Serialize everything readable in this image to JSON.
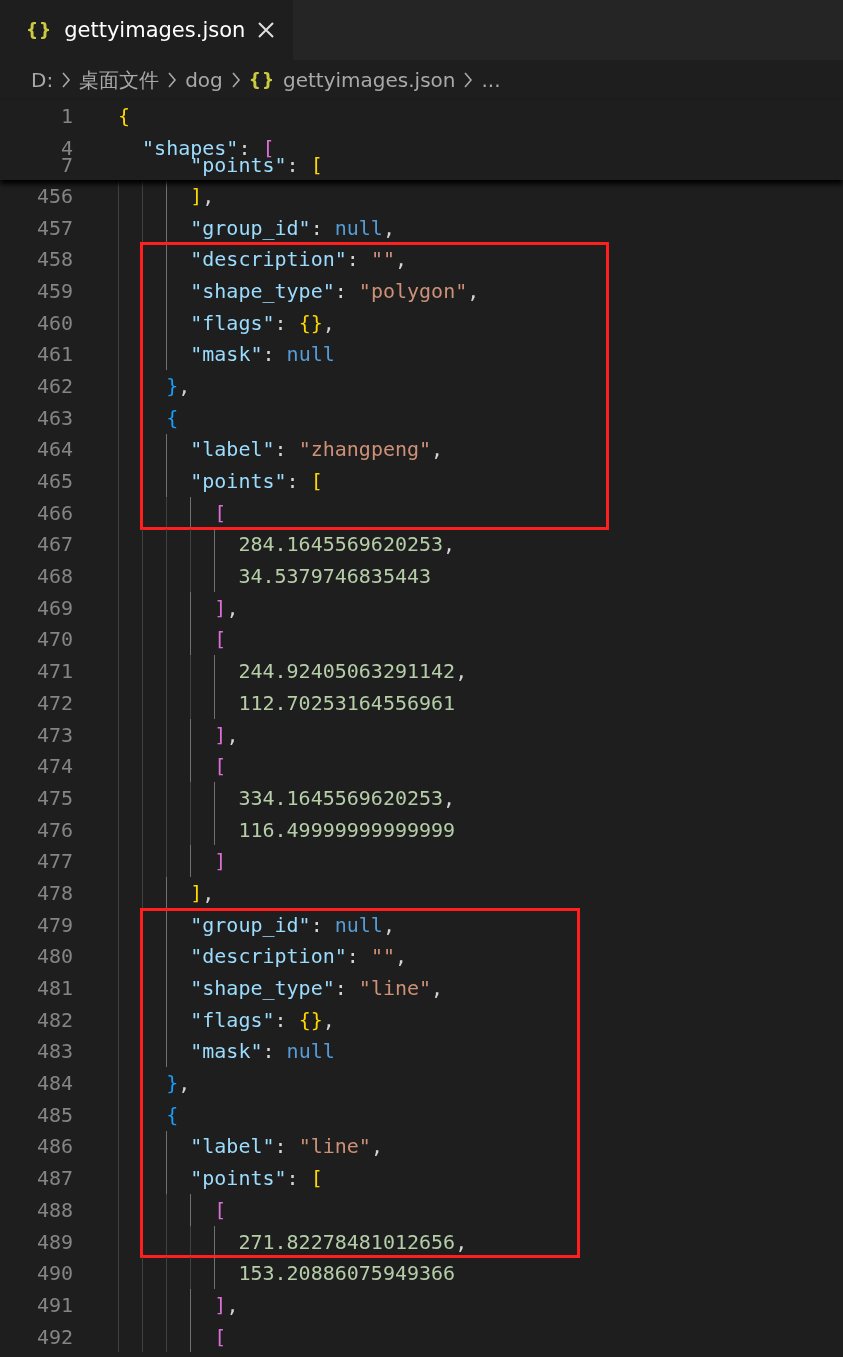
{
  "tab": {
    "icon": "{}",
    "title": "gettyimages.json",
    "selected": true
  },
  "breadcrumb": [
    {
      "text": "D:",
      "kind": "text"
    },
    {
      "text": "桌面文件",
      "kind": "text"
    },
    {
      "text": "dog",
      "kind": "text"
    },
    {
      "text": "gettyimages.json",
      "kind": "file",
      "icon": "{}"
    },
    {
      "text": "...",
      "kind": "text"
    }
  ],
  "sticky_lines": [
    {
      "n": "1",
      "tokens": [
        {
          "text": "{",
          "kind": "b1"
        }
      ]
    },
    {
      "n": "4",
      "tokens": [
        {
          "text": "  \"shapes\"",
          "kind": "k"
        },
        {
          "text": ": ",
          "kind": "p"
        },
        {
          "text": "[",
          "kind": "b2"
        }
      ]
    },
    {
      "n": "7",
      "tokens": [
        {
          "text": "      \"points\"",
          "kind": "k"
        },
        {
          "text": ": ",
          "kind": "p"
        },
        {
          "text": "[",
          "kind": "b1"
        }
      ]
    }
  ],
  "lines": [
    {
      "n": "456",
      "boxed": false,
      "tokens": [
        {
          "text": "      ]",
          "kind": "b1"
        },
        {
          "text": ",",
          "kind": "p"
        }
      ]
    },
    {
      "n": "457",
      "boxed": false,
      "tokens": [
        {
          "text": "      \"group_id\"",
          "kind": "k"
        },
        {
          "text": ": ",
          "kind": "p"
        },
        {
          "text": "null",
          "kind": "c"
        },
        {
          "text": ",",
          "kind": "p"
        }
      ]
    },
    {
      "n": "458",
      "boxed": true,
      "tokens": [
        {
          "text": "      \"description\"",
          "kind": "k"
        },
        {
          "text": ": ",
          "kind": "p"
        },
        {
          "text": "\"\"",
          "kind": "s"
        },
        {
          "text": ",",
          "kind": "p"
        }
      ]
    },
    {
      "n": "459",
      "boxed": true,
      "tokens": [
        {
          "text": "      \"shape_type\"",
          "kind": "k"
        },
        {
          "text": ": ",
          "kind": "p"
        },
        {
          "text": "\"polygon\"",
          "kind": "s"
        },
        {
          "text": ",",
          "kind": "p"
        }
      ]
    },
    {
      "n": "460",
      "boxed": true,
      "tokens": [
        {
          "text": "      \"flags\"",
          "kind": "k"
        },
        {
          "text": ": ",
          "kind": "p"
        },
        {
          "text": "{}",
          "kind": "b1"
        },
        {
          "text": ",",
          "kind": "p"
        }
      ]
    },
    {
      "n": "461",
      "boxed": true,
      "tokens": [
        {
          "text": "      \"mask\"",
          "kind": "k"
        },
        {
          "text": ": ",
          "kind": "p"
        },
        {
          "text": "null",
          "kind": "c"
        }
      ]
    },
    {
      "n": "462",
      "boxed": true,
      "tokens": [
        {
          "text": "    }",
          "kind": "b3"
        },
        {
          "text": ",",
          "kind": "p"
        }
      ]
    },
    {
      "n": "463",
      "boxed": true,
      "tokens": [
        {
          "text": "    {",
          "kind": "b3"
        }
      ]
    },
    {
      "n": "464",
      "boxed": true,
      "tokens": [
        {
          "text": "      \"label\"",
          "kind": "k"
        },
        {
          "text": ": ",
          "kind": "p"
        },
        {
          "text": "\"zhangpeng\"",
          "kind": "s"
        },
        {
          "text": ",",
          "kind": "p"
        }
      ]
    },
    {
      "n": "465",
      "boxed": true,
      "tokens": [
        {
          "text": "      \"points\"",
          "kind": "k"
        },
        {
          "text": ": ",
          "kind": "p"
        },
        {
          "text": "[",
          "kind": "b1"
        }
      ]
    },
    {
      "n": "466",
      "boxed": true,
      "tokens": [
        {
          "text": "        [",
          "kind": "b2"
        }
      ]
    },
    {
      "n": "467",
      "boxed": false,
      "tokens": [
        {
          "text": "          284.1645569620253",
          "kind": "n"
        },
        {
          "text": ",",
          "kind": "p"
        }
      ]
    },
    {
      "n": "468",
      "boxed": false,
      "tokens": [
        {
          "text": "          34.5379746835443",
          "kind": "n"
        }
      ]
    },
    {
      "n": "469",
      "boxed": false,
      "tokens": [
        {
          "text": "        ]",
          "kind": "b2"
        },
        {
          "text": ",",
          "kind": "p"
        }
      ]
    },
    {
      "n": "470",
      "boxed": false,
      "tokens": [
        {
          "text": "        [",
          "kind": "b2"
        }
      ]
    },
    {
      "n": "471",
      "boxed": false,
      "tokens": [
        {
          "text": "          244.92405063291142",
          "kind": "n"
        },
        {
          "text": ",",
          "kind": "p"
        }
      ]
    },
    {
      "n": "472",
      "boxed": false,
      "tokens": [
        {
          "text": "          112.70253164556961",
          "kind": "n"
        }
      ]
    },
    {
      "n": "473",
      "boxed": false,
      "tokens": [
        {
          "text": "        ]",
          "kind": "b2"
        },
        {
          "text": ",",
          "kind": "p"
        }
      ]
    },
    {
      "n": "474",
      "boxed": false,
      "tokens": [
        {
          "text": "        [",
          "kind": "b2"
        }
      ]
    },
    {
      "n": "475",
      "boxed": false,
      "tokens": [
        {
          "text": "          334.1645569620253",
          "kind": "n"
        },
        {
          "text": ",",
          "kind": "p"
        }
      ]
    },
    {
      "n": "476",
      "boxed": false,
      "tokens": [
        {
          "text": "          116.49999999999999",
          "kind": "n"
        }
      ]
    },
    {
      "n": "477",
      "boxed": false,
      "tokens": [
        {
          "text": "        ]",
          "kind": "b2"
        }
      ]
    },
    {
      "n": "478",
      "boxed": false,
      "tokens": [
        {
          "text": "      ]",
          "kind": "b1"
        },
        {
          "text": ",",
          "kind": "p"
        }
      ]
    },
    {
      "n": "479",
      "boxed": true,
      "tokens": [
        {
          "text": "      \"group_id\"",
          "kind": "k"
        },
        {
          "text": ": ",
          "kind": "p"
        },
        {
          "text": "null",
          "kind": "c"
        },
        {
          "text": ",",
          "kind": "p"
        }
      ]
    },
    {
      "n": "480",
      "boxed": true,
      "tokens": [
        {
          "text": "      \"description\"",
          "kind": "k"
        },
        {
          "text": ": ",
          "kind": "p"
        },
        {
          "text": "\"\"",
          "kind": "s"
        },
        {
          "text": ",",
          "kind": "p"
        }
      ]
    },
    {
      "n": "481",
      "boxed": true,
      "tokens": [
        {
          "text": "      \"shape_type\"",
          "kind": "k"
        },
        {
          "text": ": ",
          "kind": "p"
        },
        {
          "text": "\"line\"",
          "kind": "s"
        },
        {
          "text": ",",
          "kind": "p"
        }
      ]
    },
    {
      "n": "482",
      "boxed": true,
      "tokens": [
        {
          "text": "      \"flags\"",
          "kind": "k"
        },
        {
          "text": ": ",
          "kind": "p"
        },
        {
          "text": "{}",
          "kind": "b1"
        },
        {
          "text": ",",
          "kind": "p"
        }
      ]
    },
    {
      "n": "483",
      "boxed": true,
      "tokens": [
        {
          "text": "      \"mask\"",
          "kind": "k"
        },
        {
          "text": ": ",
          "kind": "p"
        },
        {
          "text": "null",
          "kind": "c"
        }
      ]
    },
    {
      "n": "484",
      "boxed": true,
      "tokens": [
        {
          "text": "    }",
          "kind": "b3"
        },
        {
          "text": ",",
          "kind": "p"
        }
      ]
    },
    {
      "n": "485",
      "boxed": true,
      "tokens": [
        {
          "text": "    {",
          "kind": "b3"
        }
      ]
    },
    {
      "n": "486",
      "boxed": true,
      "tokens": [
        {
          "text": "      \"label\"",
          "kind": "k"
        },
        {
          "text": ": ",
          "kind": "p"
        },
        {
          "text": "\"line\"",
          "kind": "s"
        },
        {
          "text": ",",
          "kind": "p"
        }
      ]
    },
    {
      "n": "487",
      "boxed": true,
      "tokens": [
        {
          "text": "      \"points\"",
          "kind": "k"
        },
        {
          "text": ": ",
          "kind": "p"
        },
        {
          "text": "[",
          "kind": "b1"
        }
      ]
    },
    {
      "n": "488",
      "boxed": true,
      "tokens": [
        {
          "text": "        [",
          "kind": "b2"
        }
      ]
    },
    {
      "n": "489",
      "boxed": true,
      "tokens": [
        {
          "text": "          271.82278481012656",
          "kind": "n"
        },
        {
          "text": ",",
          "kind": "p"
        }
      ]
    },
    {
      "n": "490",
      "boxed": false,
      "tokens": [
        {
          "text": "          153.20886075949366",
          "kind": "n"
        }
      ]
    },
    {
      "n": "491",
      "boxed": false,
      "tokens": [
        {
          "text": "        ]",
          "kind": "b2"
        },
        {
          "text": ",",
          "kind": "p"
        }
      ]
    },
    {
      "n": "492",
      "boxed": false,
      "tokens": [
        {
          "text": "        [",
          "kind": "b2"
        }
      ]
    }
  ]
}
